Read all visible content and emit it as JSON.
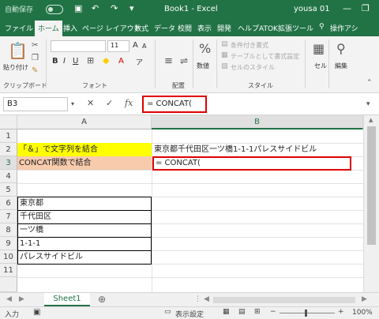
{
  "titlebar": {
    "autosave": "自動保存",
    "toggle_state": "オフ",
    "title": "Book1  -  Excel",
    "user": "yousa 01"
  },
  "tabs": [
    "ファイル",
    "ホーム",
    "挿入",
    "ページ レイアウト",
    "数式",
    "データ",
    "校閲",
    "表示",
    "開発",
    "ヘルプ",
    "ATOK拡張ツール",
    "操作アシ"
  ],
  "active_tab": "ホーム",
  "ribbon": {
    "clipboard": {
      "paste": "貼り付け",
      "label": "クリップボード"
    },
    "font": {
      "size": "11",
      "label": "フォント"
    },
    "alignment": {
      "label": "配置"
    },
    "number": {
      "label": "数値"
    },
    "styles": {
      "conditional": "条件付き書式",
      "table": "テーブルとして書式設定",
      "cell_styles": "セルのスタイル",
      "label": "スタイル"
    },
    "cells": {
      "label": "セル"
    },
    "editing": {
      "label": "編集"
    }
  },
  "formula_bar": {
    "name_box": "B3",
    "fx": "fx",
    "formula": "= CONCAT("
  },
  "grid": {
    "columns": [
      "A",
      "B"
    ],
    "rows": [
      "1",
      "2",
      "3",
      "4",
      "5",
      "6",
      "7",
      "8",
      "9",
      "10",
      "11"
    ],
    "cells": {
      "A2": "「＆」で文字列を結合",
      "B2": "東京都千代田区一ツ橋1-1-1パレスサイドビル",
      "A3": "CONCAT関数で結合",
      "B3": "= CONCAT(",
      "A6": "東京都",
      "A7": "千代田区",
      "A8": "一ツ橋",
      "A9": "1-1-1",
      "A10": "パレスサイドビル"
    },
    "colors": {
      "highlight_yellow": "#ffff00",
      "highlight_peach": "#f8cbad",
      "callout_red": "#e00000"
    }
  },
  "sheets": {
    "active": "Sheet1",
    "add_icon": "plus-icon"
  },
  "status": {
    "mode": "入力",
    "display_settings": "表示設定",
    "zoom": "100%"
  }
}
